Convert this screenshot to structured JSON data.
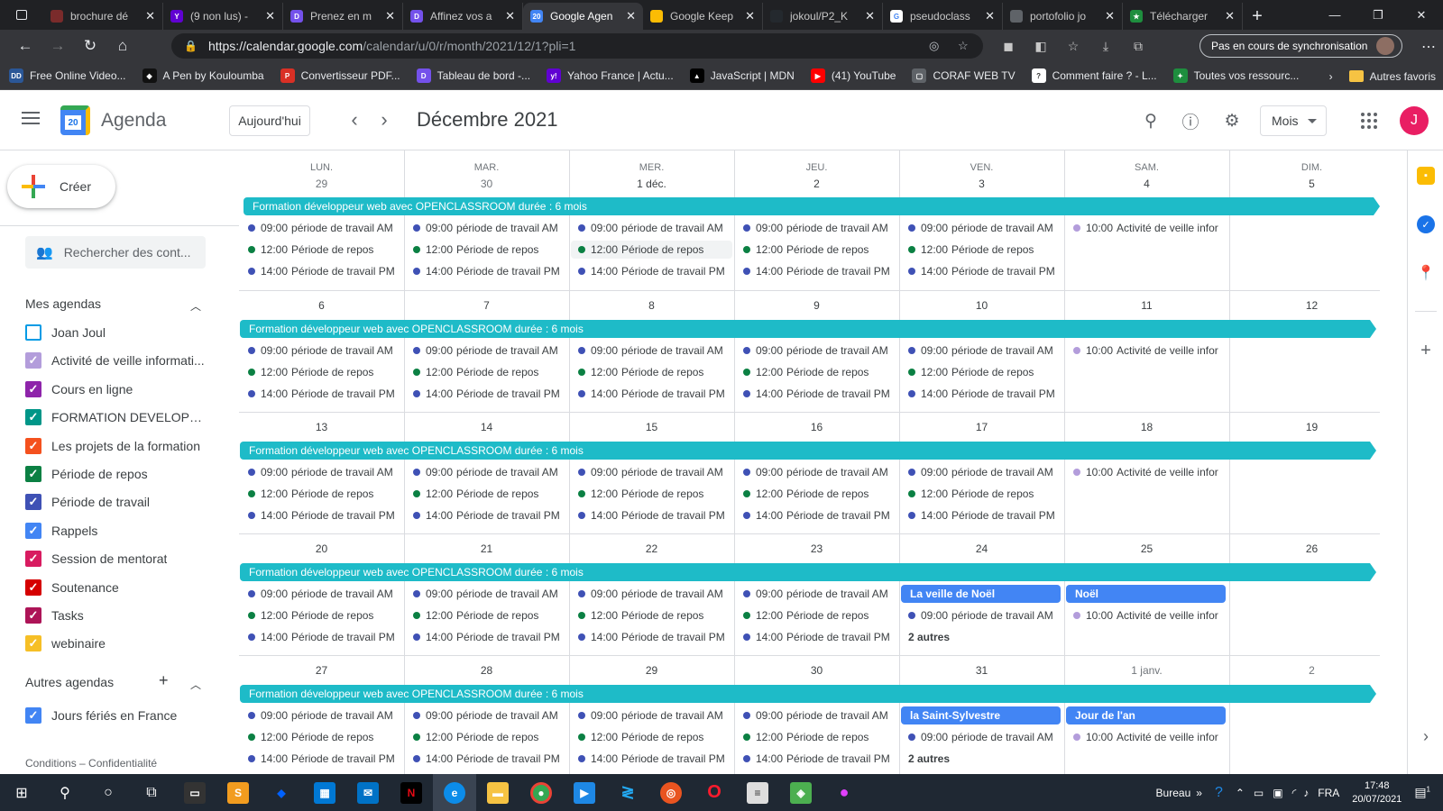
{
  "browser": {
    "tabs": [
      {
        "title": "brochure dé",
        "color": "#7a2b2b",
        "glyph": ""
      },
      {
        "title": "(9 non lus) -",
        "color": "#6001d2",
        "glyph": "Y"
      },
      {
        "title": "Prenez en m",
        "color": "#7451eb",
        "glyph": "D"
      },
      {
        "title": "Affinez vos a",
        "color": "#7451eb",
        "glyph": "D"
      },
      {
        "title": "Google Agen",
        "color": "#4285f4",
        "glyph": "20"
      },
      {
        "title": "Google Keep",
        "color": "#fbbc04",
        "glyph": ""
      },
      {
        "title": "jokoul/P2_K",
        "color": "#24292e",
        "glyph": ""
      },
      {
        "title": "pseudoclass",
        "color": "#ffffff",
        "glyph": "G"
      },
      {
        "title": "portofolio jo",
        "color": "#5f6368",
        "glyph": ""
      },
      {
        "title": "Télécharger",
        "color": "#1e8e3e",
        "glyph": "★"
      }
    ],
    "active_tab": 4,
    "url_host": "https://calendar.google.com",
    "url_path": "/calendar/u/0/r/month/2021/12/1?pli=1",
    "sync_label": "Pas en cours de synchronisation",
    "bookmarks": [
      {
        "label": "Free Online Video...",
        "color": "#2b5797",
        "glyph": "DD"
      },
      {
        "label": "A Pen by Kouloumba",
        "color": "#111111",
        "glyph": "◆"
      },
      {
        "label": "Convertisseur PDF...",
        "color": "#d93025",
        "glyph": "P"
      },
      {
        "label": "Tableau de bord -...",
        "color": "#7451eb",
        "glyph": "D"
      },
      {
        "label": "Yahoo France | Actu...",
        "color": "#6001d2",
        "glyph": "y!"
      },
      {
        "label": "JavaScript | MDN",
        "color": "#000000",
        "glyph": "▲"
      },
      {
        "label": "(41) YouTube",
        "color": "#ff0000",
        "glyph": "▶"
      },
      {
        "label": "CORAF WEB TV",
        "color": "#5f6368",
        "glyph": "▢"
      },
      {
        "label": "Comment faire ? - L...",
        "color": "#ffffff",
        "glyph": "?"
      },
      {
        "label": "Toutes vos ressourc...",
        "color": "#1e8e3e",
        "glyph": "✦"
      }
    ],
    "other_bookmarks": "Autres favoris"
  },
  "header": {
    "app_name": "Agenda",
    "logo_day": "20",
    "today_label": "Aujourd'hui",
    "period": "Décembre 2021",
    "view_label": "Mois",
    "user_initial": "J"
  },
  "sidebar": {
    "create_label": "Créer",
    "search_placeholder": "Rechercher des cont...",
    "my_calendars_label": "Mes agendas",
    "my_calendars": [
      {
        "label": "Joan Joul",
        "color": "#039be5",
        "checked": false
      },
      {
        "label": "Activité de veille informati...",
        "color": "#b39ddb",
        "checked": true
      },
      {
        "label": "Cours en ligne",
        "color": "#8e24aa",
        "checked": true
      },
      {
        "label": "FORMATION DEVELOPPE...",
        "color": "#009688",
        "checked": true
      },
      {
        "label": "Les projets de la formation",
        "color": "#f4511e",
        "checked": true
      },
      {
        "label": "Période de repos",
        "color": "#0b8043",
        "checked": true
      },
      {
        "label": "Période de travail",
        "color": "#3f51b5",
        "checked": true
      },
      {
        "label": "Rappels",
        "color": "#4285f4",
        "checked": true
      },
      {
        "label": "Session de mentorat",
        "color": "#d81b60",
        "checked": true
      },
      {
        "label": "Soutenance",
        "color": "#d50000",
        "checked": true
      },
      {
        "label": "Tasks",
        "color": "#ad1457",
        "checked": true
      },
      {
        "label": "webinaire",
        "color": "#f6bf26",
        "checked": true
      }
    ],
    "other_calendars_label": "Autres agendas",
    "other_calendars": [
      {
        "label": "Jours fériés en France",
        "color": "#4285f4",
        "checked": true
      }
    ],
    "terms": "Conditions – Confidentialité"
  },
  "calendar": {
    "weekdays": [
      "LUN.",
      "MAR.",
      "MER.",
      "JEU.",
      "VEN.",
      "SAM.",
      "DIM."
    ],
    "colors": {
      "work": "#3f51b5",
      "rest": "#0b8043",
      "watch": "#b39ddb",
      "bar": "#1ebbc8",
      "holiday": "#4285f4"
    },
    "event_texts": {
      "am": {
        "time": "09:00",
        "title": "période de travail AM"
      },
      "rest": {
        "time": "12:00",
        "title": "Période de repos"
      },
      "pm": {
        "time": "14:00",
        "title": "Période de travail PM"
      },
      "watch": {
        "time": "10:00",
        "title": "Activité de veille infor"
      }
    },
    "weeks": [
      {
        "days": [
          "29",
          "30",
          "1 déc.",
          "2",
          "3",
          "4",
          "5"
        ],
        "bar": "Formation développeur web avec OPENCLASSROOM durée : 6 mois",
        "holidays": {},
        "more": {}
      },
      {
        "days": [
          "6",
          "7",
          "8",
          "9",
          "10",
          "11",
          "12"
        ],
        "bar": "Formation développeur web avec OPENCLASSROOM durée : 6 mois",
        "holidays": {},
        "more": {}
      },
      {
        "days": [
          "13",
          "14",
          "15",
          "16",
          "17",
          "18",
          "19"
        ],
        "bar": "Formation développeur web avec OPENCLASSROOM durée : 6 mois",
        "holidays": {},
        "more": {}
      },
      {
        "days": [
          "20",
          "21",
          "22",
          "23",
          "24",
          "25",
          "26"
        ],
        "bar": "Formation développeur web avec OPENCLASSROOM durée : 6 mois",
        "holidays": {
          "4": "La veille de Noël",
          "5": "Noël"
        },
        "more": {
          "4": "2 autres"
        }
      },
      {
        "days": [
          "27",
          "28",
          "29",
          "30",
          "31",
          "1 janv.",
          "2"
        ],
        "bar": "Formation développeur web avec OPENCLASSROOM durée : 6 mois",
        "holidays": {
          "4": "la Saint-Sylvestre",
          "5": "Jour de l'an"
        },
        "more": {
          "4": "2 autres"
        }
      }
    ]
  },
  "taskbar": {
    "desktop_label": "Bureau",
    "lang": "FRA",
    "time": "17:48",
    "date": "20/07/2021",
    "notif_count": "1"
  }
}
